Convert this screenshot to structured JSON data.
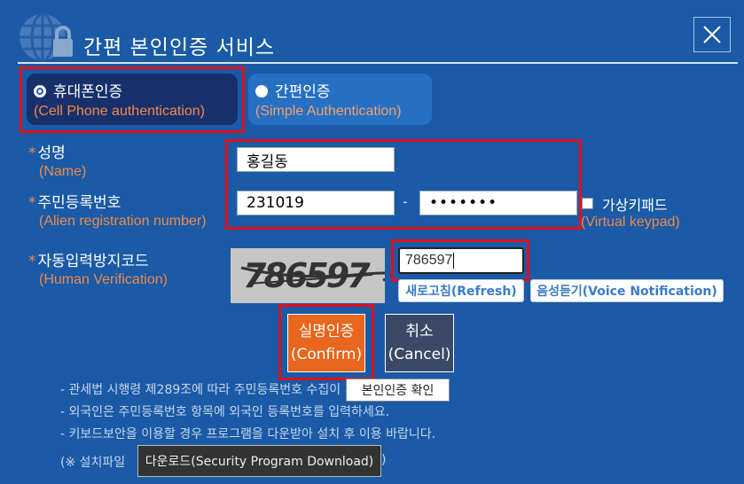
{
  "header": {
    "title": "간편 본인인증 서비스",
    "close_label": "X",
    "logo_icon": "globe-lock-icon"
  },
  "tabs": [
    {
      "label_ko": "휴대폰인증",
      "label_en": "(Cell Phone authentication)",
      "selected": true
    },
    {
      "label_ko": "간편인증",
      "label_en": "(Simple Authentication)",
      "selected": false
    }
  ],
  "form": {
    "name": {
      "label_ko": "성명",
      "label_en": "(Name)",
      "value": "홍길동"
    },
    "registration": {
      "label_ko": "주민등록번호",
      "label_en": "(Alien registration number)",
      "front_value": "231019",
      "separator": "-",
      "back_value": "•••••••"
    },
    "virtual_keypad": {
      "label_ko": "가상키패드",
      "label_en": "(Virtual keypad)",
      "checked": false
    },
    "captcha": {
      "label_ko": "자동입력방지코드",
      "label_en": "(Human Verification)",
      "image_text": "786597",
      "input_value": "786597",
      "refresh_label": "새로고침(Refresh)",
      "voice_label": "음성듣기(Voice Notification)"
    },
    "required_mark": "*"
  },
  "actions": {
    "confirm_ko": "실명인증",
    "confirm_en": "(Confirm)",
    "cancel_ko": "취소",
    "cancel_en": "(Cancel)"
  },
  "tooltip": "본인인증 확인",
  "notes": [
    "- 관세법 시행령 제289조에 따라 주민등록번호 수집이 가능합니다.",
    "- 외국인은 주민등록번호 항목에 외국인 등록번호를 입력하세요.",
    "- 키보드보안을 이용할 경우 프로그램을 다운받아 설치 후 이용 바랍니다."
  ],
  "download": {
    "prefix": "(※ 설치파일",
    "button_label": "다운로드(Security Program Download)",
    "suffix": ")"
  },
  "colors": {
    "background": "#1a5aa6",
    "accent_orange": "#e8661d",
    "highlight_red": "#e0101a"
  }
}
